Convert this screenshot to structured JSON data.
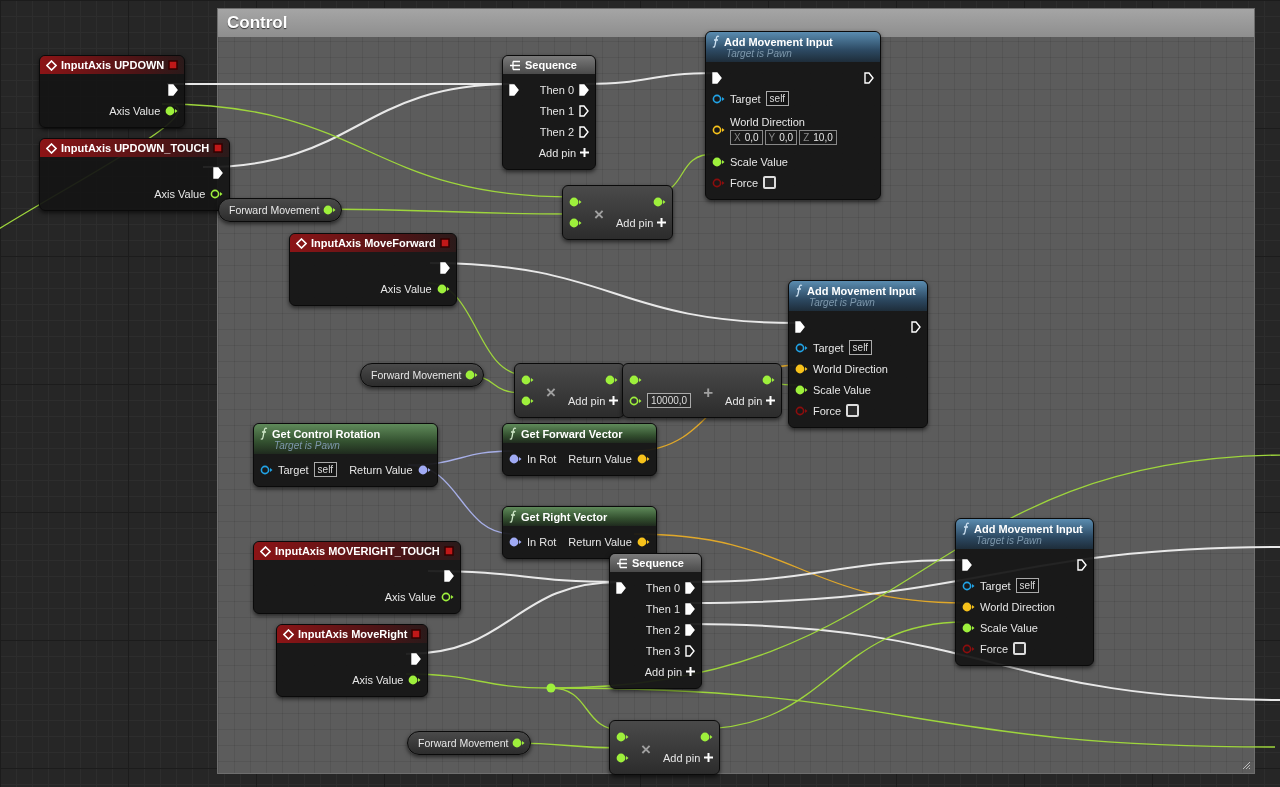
{
  "comment_box": {
    "title": "Control"
  },
  "nodes": [
    {
      "kind": "event",
      "title": "InputAxis UPDOWN",
      "outputs": [
        {
          "kind": "exec",
          "connected": true
        },
        {
          "kind": "float",
          "label": "Axis Value",
          "connected": true
        }
      ]
    },
    {
      "kind": "event",
      "title": "InputAxis UPDOWN_TOUCH",
      "outputs": [
        {
          "kind": "exec",
          "connected": true
        },
        {
          "kind": "float",
          "label": "Axis Value",
          "connected": false
        }
      ]
    },
    {
      "kind": "variable",
      "title": "Forward Movement",
      "outputs": [
        {
          "kind": "float",
          "connected": true
        }
      ]
    },
    {
      "kind": "sequence",
      "title": "Sequence",
      "add_pin": "Add pin",
      "inputs": [
        {
          "kind": "exec",
          "connected": true
        }
      ],
      "outputs": [
        {
          "kind": "exec",
          "label": "Then 0",
          "connected": true
        },
        {
          "kind": "exec",
          "label": "Then 1",
          "connected": false
        },
        {
          "kind": "exec",
          "label": "Then 2",
          "connected": false
        }
      ]
    },
    {
      "kind": "function",
      "title": "Add Movement Input",
      "subtitle": "Target is Pawn",
      "inputs": [
        {
          "kind": "exec",
          "connected": true
        },
        {
          "kind": "object",
          "label": "Target",
          "connected": false,
          "value": "self"
        },
        {
          "kind": "vector",
          "label": "World Direction",
          "connected": false,
          "values": [
            {
              "axis": "X",
              "value": "0,0"
            },
            {
              "axis": "Y",
              "value": "0,0"
            },
            {
              "axis": "Z",
              "value": "10,0"
            }
          ]
        },
        {
          "kind": "float",
          "label": "Scale Value",
          "connected": true
        },
        {
          "kind": "bool",
          "label": "Force",
          "connected": false,
          "checked": false
        }
      ],
      "outputs": [
        {
          "kind": "exec",
          "connected": false
        }
      ]
    },
    {
      "kind": "math",
      "op": "×",
      "add_pin": "Add pin",
      "inputs": [
        {
          "kind": "float",
          "connected": true
        },
        {
          "kind": "float",
          "connected": true
        }
      ],
      "outputs": [
        {
          "kind": "float",
          "connected": true
        }
      ]
    },
    {
      "kind": "event",
      "title": "InputAxis MoveForward",
      "outputs": [
        {
          "kind": "exec",
          "connected": true
        },
        {
          "kind": "float",
          "label": "Axis Value",
          "connected": true
        }
      ]
    },
    {
      "kind": "function",
      "title": "Add Movement Input",
      "subtitle": "Target is Pawn",
      "inputs": [
        {
          "kind": "exec",
          "connected": true
        },
        {
          "kind": "object",
          "label": "Target",
          "connected": false,
          "value": "self"
        },
        {
          "kind": "vector",
          "label": "World Direction",
          "connected": true
        },
        {
          "kind": "float",
          "label": "Scale Value",
          "connected": true
        },
        {
          "kind": "bool",
          "label": "Force",
          "connected": false,
          "checked": false
        }
      ],
      "outputs": [
        {
          "kind": "exec",
          "connected": false
        }
      ]
    },
    {
      "kind": "variable",
      "title": "Forward Movement",
      "outputs": [
        {
          "kind": "float",
          "connected": true
        }
      ]
    },
    {
      "kind": "math",
      "op": "×",
      "add_pin": "Add pin",
      "inputs": [
        {
          "kind": "float",
          "connected": true
        },
        {
          "kind": "float",
          "connected": true
        }
      ],
      "outputs": [
        {
          "kind": "float",
          "connected": true
        }
      ]
    },
    {
      "kind": "math",
      "op": "+",
      "add_pin": "Add pin",
      "inputs": [
        {
          "kind": "float",
          "connected": true
        },
        {
          "kind": "float",
          "connected": false,
          "value": "10000,0"
        }
      ],
      "outputs": [
        {
          "kind": "float",
          "connected": true
        }
      ]
    },
    {
      "kind": "pure",
      "title": "Get Control Rotation",
      "subtitle": "Target is Pawn",
      "inputs": [
        {
          "kind": "object",
          "label": "Target",
          "connected": false,
          "value": "self"
        }
      ],
      "outputs": [
        {
          "kind": "rotator",
          "label": "Return Value",
          "connected": true
        }
      ]
    },
    {
      "kind": "pure",
      "title": "Get Forward Vector",
      "inputs": [
        {
          "kind": "rotator",
          "label": "In Rot",
          "connected": true
        }
      ],
      "outputs": [
        {
          "kind": "vector",
          "label": "Return Value",
          "connected": true
        }
      ]
    },
    {
      "kind": "pure",
      "title": "Get Right Vector",
      "inputs": [
        {
          "kind": "rotator",
          "label": "In Rot",
          "connected": true
        }
      ],
      "outputs": [
        {
          "kind": "vector",
          "label": "Return Value",
          "connected": true
        }
      ]
    },
    {
      "kind": "event",
      "title": "InputAxis MOVERIGHT_TOUCH",
      "outputs": [
        {
          "kind": "exec",
          "connected": true
        },
        {
          "kind": "float",
          "label": "Axis Value",
          "connected": false
        }
      ]
    },
    {
      "kind": "sequence",
      "title": "Sequence",
      "add_pin": "Add pin",
      "inputs": [
        {
          "kind": "exec",
          "connected": true
        }
      ],
      "outputs": [
        {
          "kind": "exec",
          "label": "Then 0",
          "connected": true
        },
        {
          "kind": "exec",
          "label": "Then 1",
          "connected": true
        },
        {
          "kind": "exec",
          "label": "Then 2",
          "connected": true
        },
        {
          "kind": "exec",
          "label": "Then 3",
          "connected": false
        }
      ]
    },
    {
      "kind": "event",
      "title": "InputAxis MoveRight",
      "outputs": [
        {
          "kind": "exec",
          "connected": true
        },
        {
          "kind": "float",
          "label": "Axis Value",
          "connected": true
        }
      ]
    },
    {
      "kind": "function",
      "title": "Add Movement Input",
      "subtitle": "Target is Pawn",
      "inputs": [
        {
          "kind": "exec",
          "connected": true
        },
        {
          "kind": "object",
          "label": "Target",
          "connected": false,
          "value": "self"
        },
        {
          "kind": "vector",
          "label": "World Direction",
          "connected": true
        },
        {
          "kind": "float",
          "label": "Scale Value",
          "connected": true
        },
        {
          "kind": "bool",
          "label": "Force",
          "connected": false,
          "checked": false
        }
      ],
      "outputs": [
        {
          "kind": "exec",
          "connected": false
        }
      ]
    },
    {
      "kind": "variable",
      "title": "Forward Movement",
      "outputs": [
        {
          "kind": "float",
          "connected": true
        }
      ]
    },
    {
      "kind": "math",
      "op": "×",
      "add_pin": "Add pin",
      "inputs": [
        {
          "kind": "float",
          "connected": true
        },
        {
          "kind": "float",
          "connected": true
        }
      ],
      "outputs": [
        {
          "kind": "float",
          "connected": true
        }
      ]
    }
  ]
}
